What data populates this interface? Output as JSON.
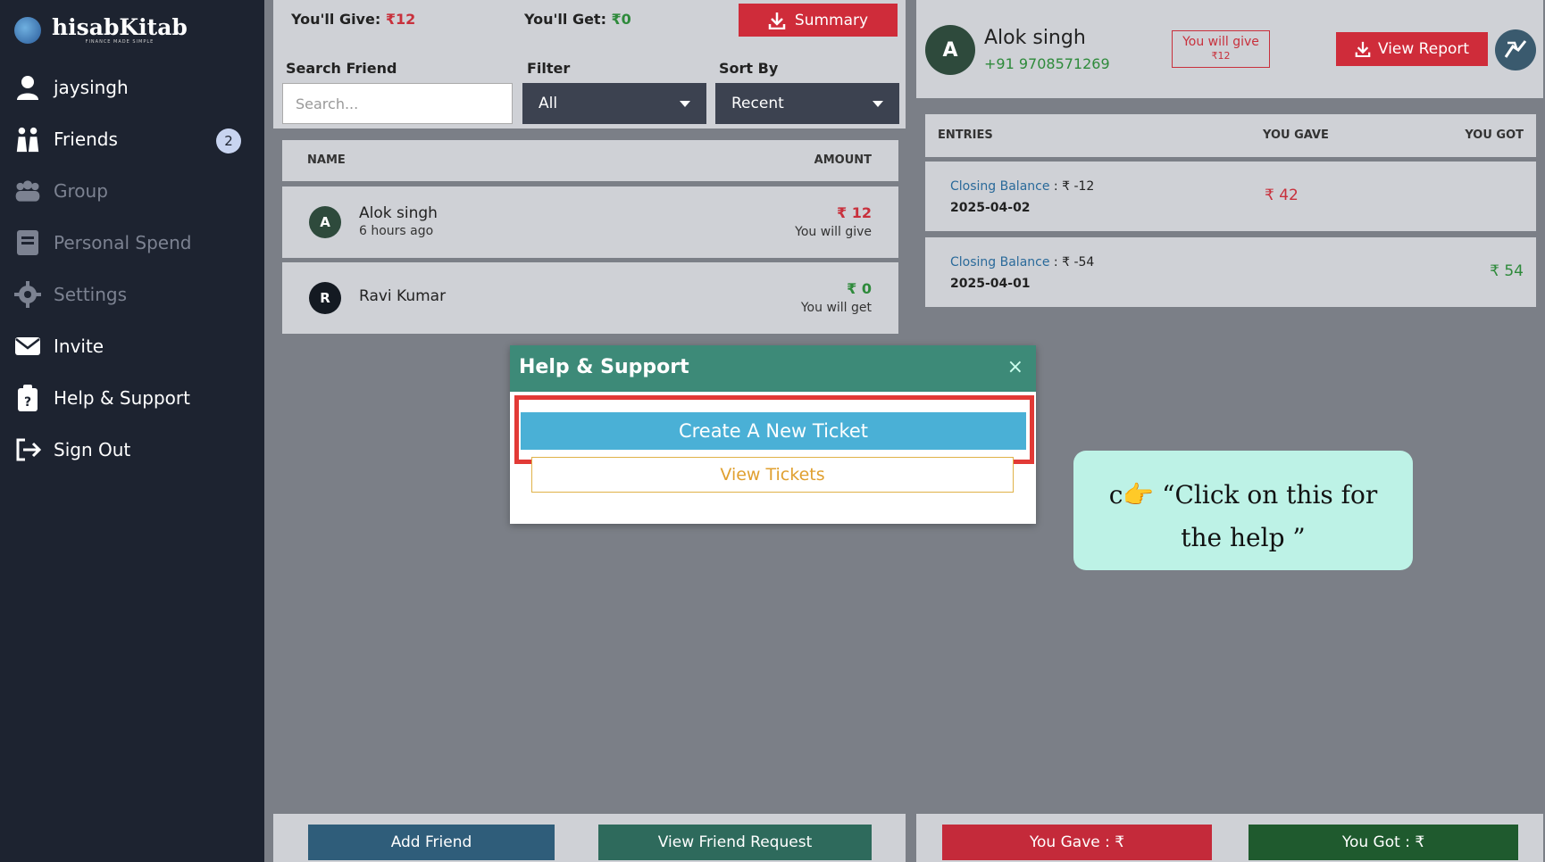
{
  "brand": {
    "name": "hisabKitab",
    "tagline": "FINANCE MADE SIMPLE"
  },
  "sidebar": {
    "items": [
      {
        "label": "jaysingh",
        "icon": "user-icon"
      },
      {
        "label": "Friends",
        "icon": "friends-icon",
        "badge": "2"
      },
      {
        "label": "Group",
        "icon": "group-icon"
      },
      {
        "label": "Personal Spend",
        "icon": "book-icon"
      },
      {
        "label": "Settings",
        "icon": "gear-icon"
      },
      {
        "label": "Invite",
        "icon": "envelope-icon"
      },
      {
        "label": "Help & Support",
        "icon": "clipboard-question-icon"
      },
      {
        "label": "Sign Out",
        "icon": "sign-out-icon"
      }
    ]
  },
  "summary": {
    "give_label": "You'll Give:",
    "give_value": "₹12",
    "get_label": "You'll Get:",
    "get_value": "₹0",
    "summary_button": "Summary"
  },
  "filters": {
    "search_label": "Search Friend",
    "search_placeholder": "Search...",
    "filter_label": "Filter",
    "filter_value": "All",
    "sort_label": "Sort By",
    "sort_value": "Recent"
  },
  "friend_list": {
    "columns": [
      "NAME",
      "AMOUNT"
    ],
    "rows": [
      {
        "initial": "A",
        "name": "Alok singh",
        "time": "6 hours ago",
        "amount": "₹ 12",
        "status": "You will give"
      },
      {
        "initial": "R",
        "name": "Ravi Kumar",
        "time": "",
        "amount": "₹ 0",
        "status": "You will get"
      }
    ]
  },
  "mid_footer": {
    "add_friend": "Add Friend",
    "view_requests": "View Friend Request"
  },
  "detail": {
    "initial": "A",
    "name": "Alok singh",
    "phone": "+91 9708571269",
    "badge_line1": "You will give",
    "badge_line2": "₹12",
    "report_button": "View Report",
    "columns": [
      "ENTRIES",
      "YOU GAVE",
      "YOU GOT"
    ],
    "entries": [
      {
        "label": "Closing Balance",
        "balance": "₹ -12",
        "date": "2025-04-02",
        "gave": "₹ 42",
        "got": ""
      },
      {
        "label": "Closing Balance",
        "balance": "₹ -54",
        "date": "2025-04-01",
        "gave": "",
        "got": "₹ 54"
      }
    ],
    "you_gave_button": "You Gave : ₹",
    "you_got_button": "You Got : ₹"
  },
  "modal": {
    "title": "Help & Support",
    "close": "×",
    "create_ticket": "Create A New Ticket",
    "view_tickets": "View Tickets"
  },
  "callout": {
    "line1": "c👉 “Click on this  for",
    "line2": "the help ”"
  },
  "colors": {
    "accent_red": "#cf2c3a",
    "accent_green": "#2e8a3b",
    "modal_header": "#3d8a78",
    "create_button": "#4ab0d6"
  }
}
